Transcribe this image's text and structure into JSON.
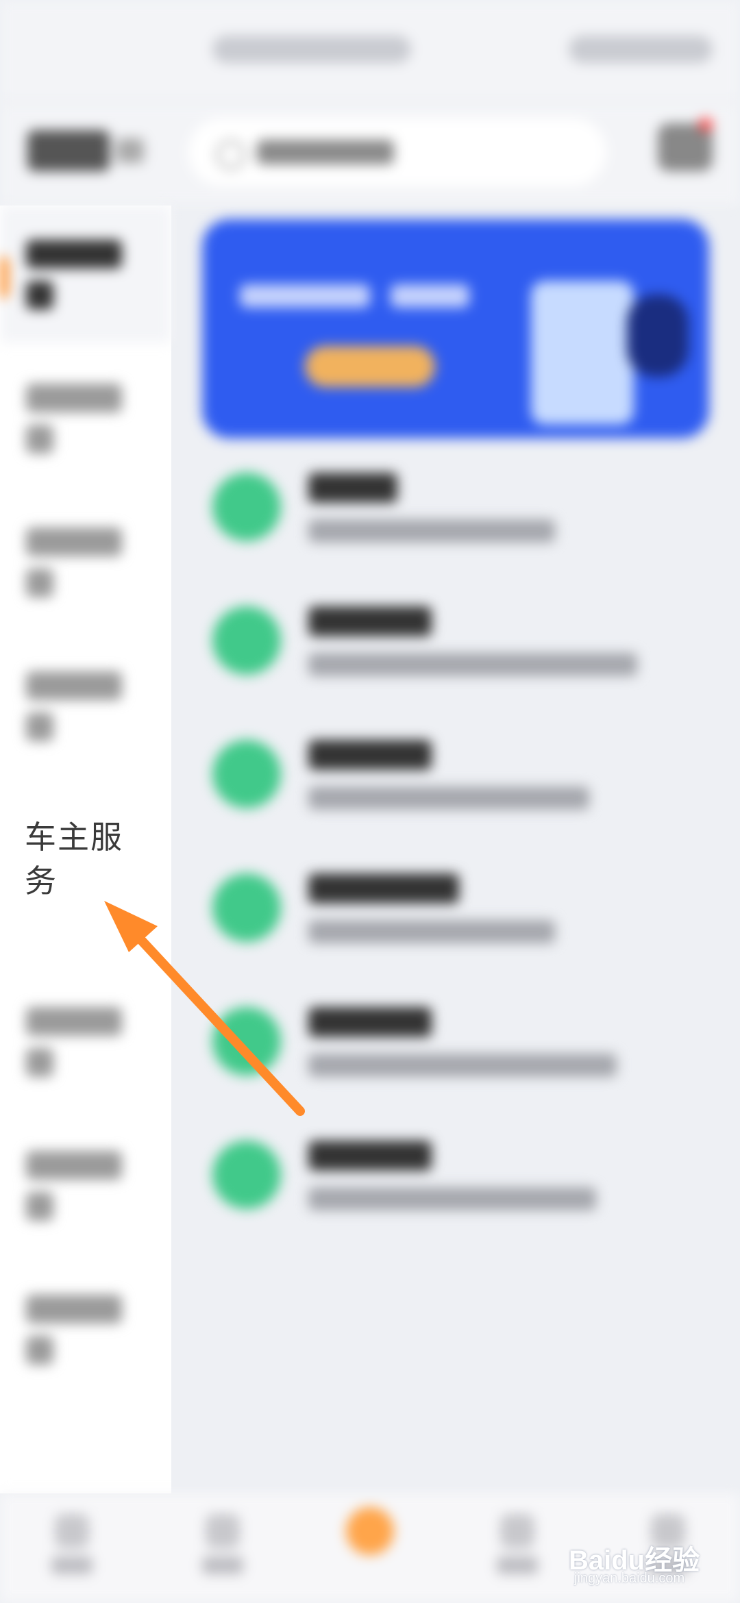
{
  "sidebar": {
    "highlighted_label": "车主服务",
    "highlighted_label_line2": "务",
    "highlighted_label_line1": "车主服"
  },
  "annotation": {
    "arrow_color": "#ff8a2a"
  },
  "colors": {
    "banner": "#2f5cf0",
    "accent": "#ff8a1f",
    "list_icon": "#41c98a"
  },
  "watermark": {
    "logo_text": "Baidu经验",
    "url": "jingyan.baidu.com"
  }
}
